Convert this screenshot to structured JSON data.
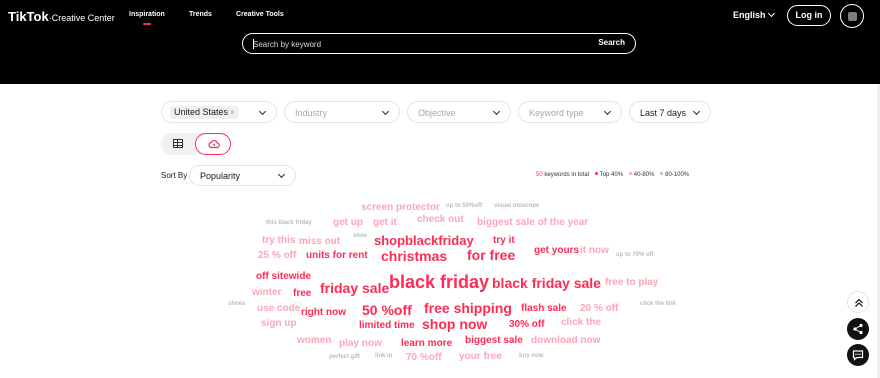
{
  "header": {
    "logo": "TikTok",
    "logo_sep": "·",
    "logo_suffix": "Creative Center",
    "nav": [
      "Inspiration",
      "Trends",
      "Creative Tools"
    ],
    "language": "English",
    "login": "Log in"
  },
  "search": {
    "placeholder": "Search by keyword",
    "button": "Search"
  },
  "filters": {
    "country_tag": "United States",
    "industry": "Industry",
    "objective": "Objective",
    "keyword_type": "Keyword type",
    "period": "Last 7 days"
  },
  "sort": {
    "label": "Sort By",
    "value": "Popularity"
  },
  "legend": {
    "count": "50",
    "count_suffix": "keywords in total",
    "top": "Top 40%",
    "mid": "40-80%",
    "low": "80-100%"
  },
  "colors": {
    "accent": "#fe2c55",
    "mid": "#fda6b7",
    "low": "#bbbbbb"
  },
  "word_cloud": [
    {
      "text": "screen protector",
      "tier": 2,
      "size": 10
    },
    {
      "text": "up to 50%off",
      "tier": 3,
      "size": 6
    },
    {
      "text": "visual otoscope",
      "tier": 3,
      "size": 6
    },
    {
      "text": "this black friday",
      "tier": 3,
      "size": 6
    },
    {
      "text": "get up",
      "tier": 2,
      "size": 10
    },
    {
      "text": "get it",
      "tier": 2,
      "size": 10
    },
    {
      "text": "check out",
      "tier": 2,
      "size": 10
    },
    {
      "text": "biggest sale of the year",
      "tier": 2,
      "size": 10
    },
    {
      "text": "shoe",
      "tier": 3,
      "size": 6
    },
    {
      "text": "try this",
      "tier": 2,
      "size": 10
    },
    {
      "text": "miss out",
      "tier": 2,
      "size": 10
    },
    {
      "text": "shopblackfriday",
      "tier": 1,
      "size": 13
    },
    {
      "text": "try it",
      "tier": 1,
      "size": 10
    },
    {
      "text": "25 % off",
      "tier": 2,
      "size": 10
    },
    {
      "text": "units for rent",
      "tier": 1,
      "size": 10
    },
    {
      "text": "christmas",
      "tier": 1,
      "size": 14
    },
    {
      "text": "for free",
      "tier": 1,
      "size": 14
    },
    {
      "text": "get yours",
      "tier": 1,
      "size": 10
    },
    {
      "text": "it now",
      "tier": 2,
      "size": 10
    },
    {
      "text": "up to 70% off",
      "tier": 3,
      "size": 6
    },
    {
      "text": "off sitewide",
      "tier": 1,
      "size": 10
    },
    {
      "text": "black friday",
      "tier": 1,
      "size": 18
    },
    {
      "text": "black friday sale",
      "tier": 1,
      "size": 14
    },
    {
      "text": "free to play",
      "tier": 2,
      "size": 10
    },
    {
      "text": "winter",
      "tier": 2,
      "size": 10
    },
    {
      "text": "free",
      "tier": 1,
      "size": 10
    },
    {
      "text": "friday sale",
      "tier": 1,
      "size": 14
    },
    {
      "text": "shoes",
      "tier": 3,
      "size": 6
    },
    {
      "text": "use code",
      "tier": 2,
      "size": 10
    },
    {
      "text": "right now",
      "tier": 1,
      "size": 10
    },
    {
      "text": "50 %off",
      "tier": 1,
      "size": 14
    },
    {
      "text": "free shipping",
      "tier": 1,
      "size": 14
    },
    {
      "text": "flash sale",
      "tier": 1,
      "size": 10
    },
    {
      "text": "20 % off",
      "tier": 2,
      "size": 10
    },
    {
      "text": "click the link",
      "tier": 3,
      "size": 6
    },
    {
      "text": "sign up",
      "tier": 2,
      "size": 10
    },
    {
      "text": "limited time",
      "tier": 1,
      "size": 10
    },
    {
      "text": "shop now",
      "tier": 1,
      "size": 14
    },
    {
      "text": "30% off",
      "tier": 1,
      "size": 10
    },
    {
      "text": "click the",
      "tier": 2,
      "size": 10
    },
    {
      "text": "women",
      "tier": 2,
      "size": 10
    },
    {
      "text": "play now",
      "tier": 2,
      "size": 10
    },
    {
      "text": "learn more",
      "tier": 1,
      "size": 10
    },
    {
      "text": "biggest sale",
      "tier": 1,
      "size": 10
    },
    {
      "text": "download now",
      "tier": 2,
      "size": 10
    },
    {
      "text": "perfect gift",
      "tier": 3,
      "size": 6
    },
    {
      "text": "link in",
      "tier": 3,
      "size": 6
    },
    {
      "text": "70 %off",
      "tier": 2,
      "size": 10
    },
    {
      "text": "your free",
      "tier": 2,
      "size": 10
    },
    {
      "text": "buy now",
      "tier": 3,
      "size": 6
    }
  ]
}
